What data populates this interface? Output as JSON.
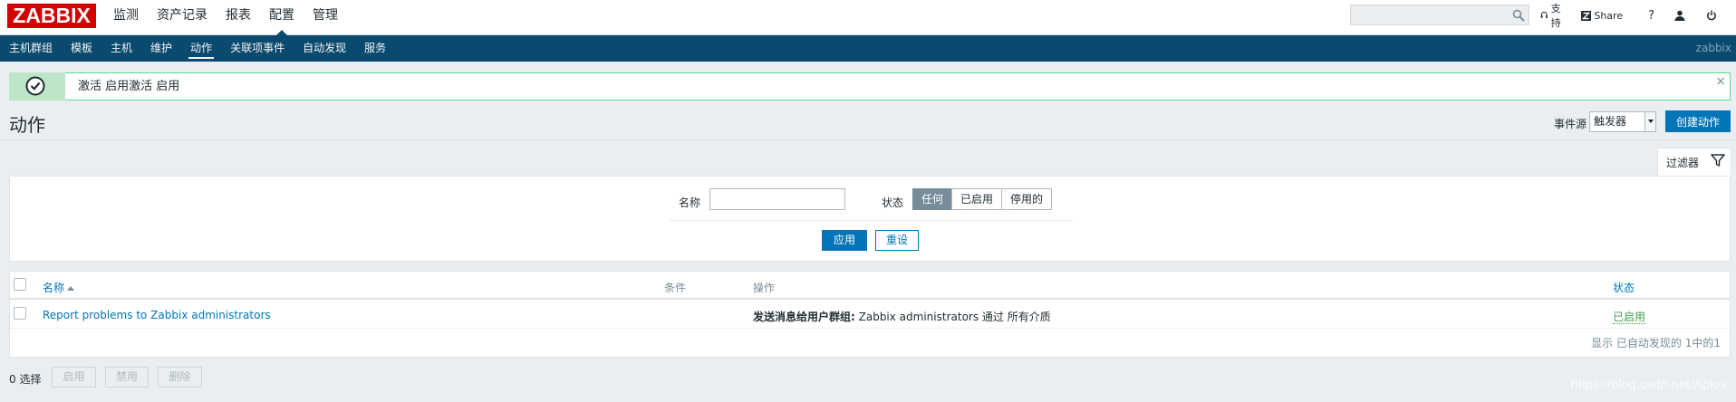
{
  "header": {
    "logo": "ZABBIX",
    "menu": [
      "监测",
      "资产记录",
      "报表",
      "配置",
      "管理"
    ],
    "active_menu": 3,
    "search": {
      "placeholder": "",
      "value": ""
    },
    "support": "支持",
    "share": "Share",
    "help": "?"
  },
  "subnav": {
    "items": [
      "主机群组",
      "模板",
      "主机",
      "维护",
      "动作",
      "关联项事件",
      "自动发现",
      "服务"
    ],
    "active": 4,
    "server_name": "zabbix"
  },
  "message": {
    "text": "激活 启用激活 启用",
    "close": "×"
  },
  "page": {
    "title": "动作",
    "event_source_label": "事件源",
    "event_source_value": "触发器",
    "create_button": "创建动作"
  },
  "filter": {
    "tab_label": "过滤器",
    "name_label": "名称",
    "name_value": "",
    "status_label": "状态",
    "status_options": [
      "任何",
      "已启用",
      "停用的"
    ],
    "status_selected": 0,
    "apply": "应用",
    "reset": "重设"
  },
  "table": {
    "headers": {
      "name": "名称",
      "conditions": "条件",
      "operations": "操作",
      "status": "状态"
    },
    "rows": [
      {
        "name": "Report problems to Zabbix administrators",
        "conditions": "",
        "operation_bold": "发送消息给用户群组:",
        "operation_rest": " Zabbix administrators 通过 所有介质",
        "status": "已启用"
      }
    ],
    "footer": "显示 已自动发现的 1中的1"
  },
  "actions": {
    "selected": "0 选择",
    "enable": "启用",
    "disable": "禁用",
    "delete": "删除"
  },
  "watermark": "https://blog.csdn.net/Aplox",
  "colors": {
    "nav_bg": "#0b4a6f",
    "primary": "#0275b8",
    "logo_red": "#d40000",
    "success_border": "#59db8f",
    "enabled_green": "#429e47"
  }
}
